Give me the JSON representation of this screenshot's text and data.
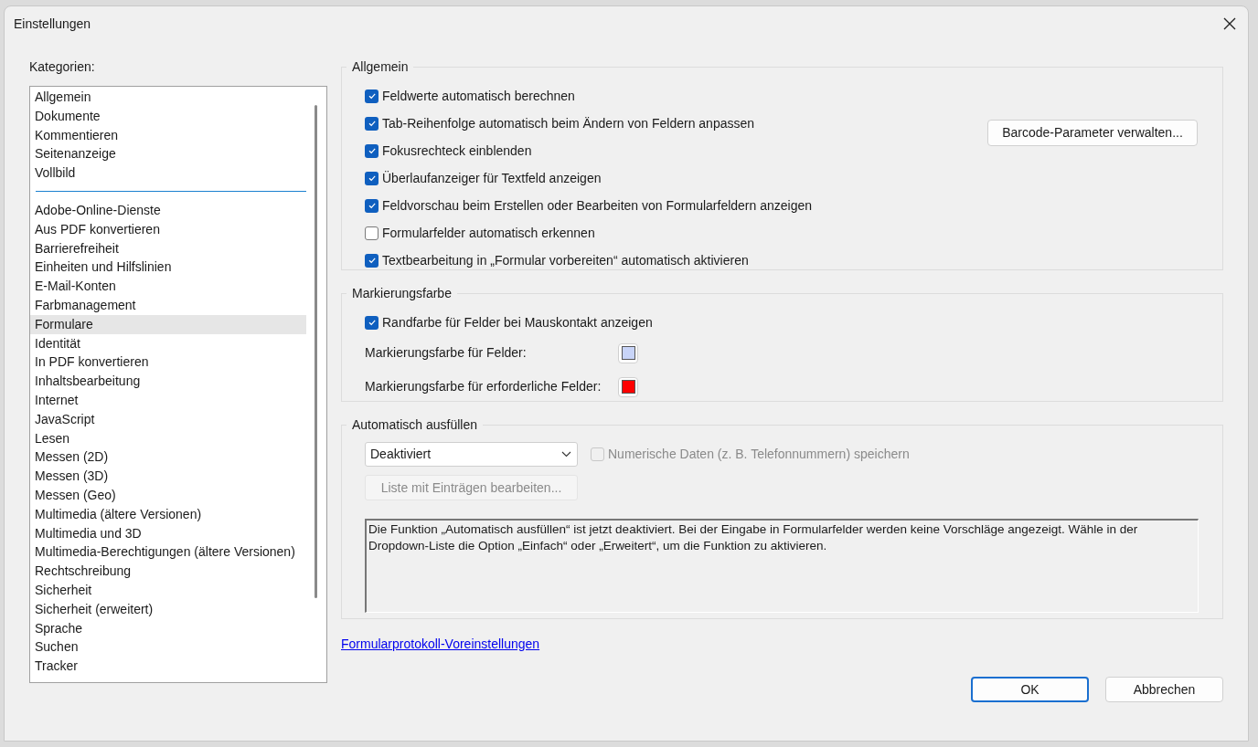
{
  "window": {
    "title": "Einstellungen"
  },
  "categories": {
    "label": "Kategorien:",
    "groups": [
      {
        "items": [
          {
            "label": "Allgemein",
            "selected": false
          },
          {
            "label": "Dokumente",
            "selected": false
          },
          {
            "label": "Kommentieren",
            "selected": false
          },
          {
            "label": "Seitenanzeige",
            "selected": false
          },
          {
            "label": "Vollbild",
            "selected": false
          }
        ]
      },
      {
        "items": [
          {
            "label": "Adobe-Online-Dienste",
            "selected": false
          },
          {
            "label": "Aus PDF konvertieren",
            "selected": false
          },
          {
            "label": "Barrierefreiheit",
            "selected": false
          },
          {
            "label": "Einheiten und Hilfslinien",
            "selected": false
          },
          {
            "label": "E-Mail-Konten",
            "selected": false
          },
          {
            "label": "Farbmanagement",
            "selected": false
          },
          {
            "label": "Formulare",
            "selected": true
          },
          {
            "label": "Identität",
            "selected": false
          },
          {
            "label": "In PDF konvertieren",
            "selected": false
          },
          {
            "label": "Inhaltsbearbeitung",
            "selected": false
          },
          {
            "label": "Internet",
            "selected": false
          },
          {
            "label": "JavaScript",
            "selected": false
          },
          {
            "label": "Lesen",
            "selected": false
          },
          {
            "label": "Messen (2D)",
            "selected": false
          },
          {
            "label": "Messen (3D)",
            "selected": false
          },
          {
            "label": "Messen (Geo)",
            "selected": false
          },
          {
            "label": "Multimedia (ältere Versionen)",
            "selected": false
          },
          {
            "label": "Multimedia und 3D",
            "selected": false
          },
          {
            "label": "Multimedia-Berechtigungen (ältere Versionen)",
            "selected": false
          },
          {
            "label": "Rechtschreibung",
            "selected": false
          },
          {
            "label": "Sicherheit",
            "selected": false
          },
          {
            "label": "Sicherheit (erweitert)",
            "selected": false
          },
          {
            "label": "Sprache",
            "selected": false
          },
          {
            "label": "Suchen",
            "selected": false
          },
          {
            "label": "Tracker",
            "selected": false
          }
        ]
      }
    ]
  },
  "general": {
    "title": "Allgemein",
    "checkboxes": [
      {
        "label": "Feldwerte automatisch berechnen",
        "checked": true
      },
      {
        "label": "Tab-Reihenfolge automatisch beim Ändern von Feldern anpassen",
        "checked": true
      },
      {
        "label": "Fokusrechteck einblenden",
        "checked": true
      },
      {
        "label": "Überlaufanzeiger für Textfeld anzeigen",
        "checked": true
      },
      {
        "label": "Feldvorschau beim Erstellen oder Bearbeiten von Formularfeldern anzeigen",
        "checked": true
      },
      {
        "label": "Formularfelder automatisch erkennen",
        "checked": false
      },
      {
        "label": "Textbearbeitung in „Formular vorbereiten“ automatisch aktivieren",
        "checked": true
      }
    ],
    "button": "Barcode-Parameter verwalten..."
  },
  "highlight": {
    "title": "Markierungsfarbe",
    "checkbox": {
      "label": "Randfarbe für Felder bei Mauskontakt anzeigen",
      "checked": true
    },
    "colors": [
      {
        "label": "Markierungsfarbe für Felder:",
        "color": "#c8d4f8"
      },
      {
        "label": "Markierungsfarbe für erforderliche Felder:",
        "color": "#ff0000"
      }
    ]
  },
  "autofill": {
    "title": "Automatisch ausfüllen",
    "dropdown": "Deaktiviert",
    "numeric": {
      "label": "Numerische Daten (z. B. Telefonnummern) speichern",
      "checked": false,
      "disabled": true
    },
    "edit_button": {
      "label": "Liste mit Einträgen bearbeiten...",
      "disabled": true
    },
    "description": "Die Funktion „Automatisch ausfüllen“ ist jetzt deaktiviert. Bei der Eingabe in Formularfelder werden keine Vorschläge angezeigt. Wähle in der Dropdown-Liste die Option „Einfach“ oder „Erweitert“, um die Funktion zu aktivieren."
  },
  "link": "Formularprotokoll-Voreinstellungen",
  "buttons": [
    {
      "label": "OK",
      "default": true
    },
    {
      "label": "Abbrechen",
      "default": false
    }
  ]
}
